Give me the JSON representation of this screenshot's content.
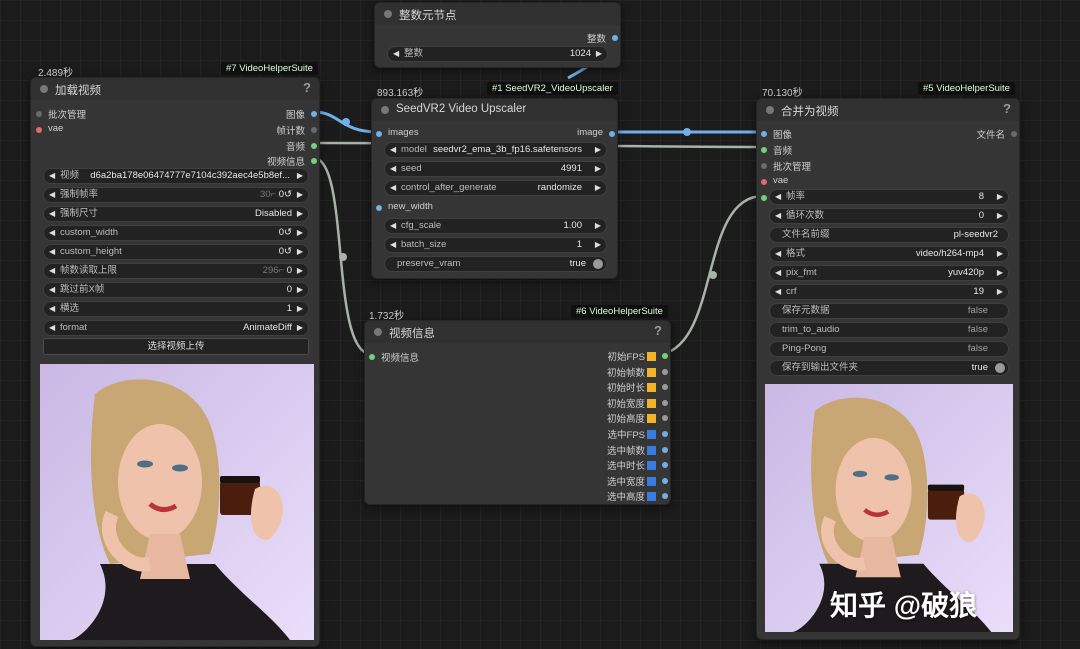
{
  "colors": {
    "canvas": "#1b1b1b",
    "node_body": "#353535",
    "wire_image": "#6fb0e8",
    "wire_default": "#a9b1a9",
    "badge_yellow": "#f0b429",
    "badge_blue": "#3a7be0"
  },
  "int_node": {
    "title": "整数元节点",
    "output": "整数",
    "widget_label": "整数",
    "widget_value": "1024"
  },
  "load_node": {
    "time": "2.489秒",
    "tag": "#7 VideoHelperSuite",
    "title": "加载视频",
    "help": "?",
    "inputs": [
      "批次管理",
      "vae"
    ],
    "outputs": [
      "图像",
      "帧计数",
      "音频",
      "视频信息"
    ],
    "widgets": [
      {
        "label": "视频",
        "value": "d6a2ba178e06474777e7104c392aec4e5b8ef..."
      },
      {
        "label": "强制帧率",
        "hint": "30⌐",
        "value": "0↺"
      },
      {
        "label": "强制尺寸",
        "value": "Disabled"
      },
      {
        "label": "custom_width",
        "value": "0↺"
      },
      {
        "label": "custom_height",
        "value": "0↺"
      },
      {
        "label": "帧数读取上限",
        "hint": "296⌐",
        "value": "0"
      },
      {
        "label": "跳过前X帧",
        "value": "0"
      },
      {
        "label": "横选",
        "value": "1"
      },
      {
        "label": "format",
        "value": "AnimateDiff"
      }
    ],
    "upload_button": "选择视频上传"
  },
  "seed_node": {
    "time": "893.163秒",
    "tag": "#1 SeedVR2_VideoUpscaler",
    "title": "SeedVR2 Video Upscaler",
    "input": "images",
    "output": "image",
    "widgets": [
      {
        "label": "model",
        "value": "seedvr2_ema_3b_fp16.safetensors"
      },
      {
        "label": "seed",
        "value": "4991"
      },
      {
        "label": "control_after_generate",
        "value": "randomize"
      }
    ],
    "input2": "new_width",
    "widgets2": [
      {
        "label": "cfg_scale",
        "value": "1.00"
      },
      {
        "label": "batch_size",
        "value": "1"
      }
    ],
    "toggle": {
      "label": "preserve_vram",
      "value": "true"
    }
  },
  "info_node": {
    "time": "1.732秒",
    "tag": "#6 VideoHelperSuite",
    "title": "视频信息",
    "help": "?",
    "input": "视频信息",
    "outputs": [
      {
        "label": "初始FPS",
        "badge": "yellow"
      },
      {
        "label": "初始帧数",
        "badge": "yellow"
      },
      {
        "label": "初始时长",
        "badge": "yellow"
      },
      {
        "label": "初始宽度",
        "badge": "yellow"
      },
      {
        "label": "初始高度",
        "badge": "yellow"
      },
      {
        "label": "选中FPS",
        "badge": "blue"
      },
      {
        "label": "选中帧数",
        "badge": "blue"
      },
      {
        "label": "选中时长",
        "badge": "blue"
      },
      {
        "label": "选中宽度",
        "badge": "blue"
      },
      {
        "label": "选中高度",
        "badge": "blue"
      }
    ]
  },
  "merge_node": {
    "time": "70.130秒",
    "tag": "#5 VideoHelperSuite",
    "title": "合并为视频",
    "help": "?",
    "inputs": [
      "图像",
      "音频",
      "批次管理",
      "vae"
    ],
    "output": "文件名",
    "widgets": [
      {
        "label": "帧率",
        "value": "8"
      },
      {
        "label": "循环次数",
        "value": "0"
      }
    ],
    "text_widget": {
      "label": "文件名前缀",
      "value": "pl-seedvr2"
    },
    "widgets2": [
      {
        "label": "格式",
        "value": "video/h264-mp4"
      },
      {
        "label": "pix_fmt",
        "value": "yuv420p"
      },
      {
        "label": "crf",
        "value": "19"
      }
    ],
    "toggles": [
      {
        "label": "保存元数据",
        "value": "false"
      },
      {
        "label": "trim_to_audio",
        "value": "false"
      },
      {
        "label": "Ping-Pong",
        "value": "false"
      },
      {
        "label": "保存到输出文件夹",
        "value": "true"
      }
    ]
  },
  "watermark": "知乎 @破狼"
}
